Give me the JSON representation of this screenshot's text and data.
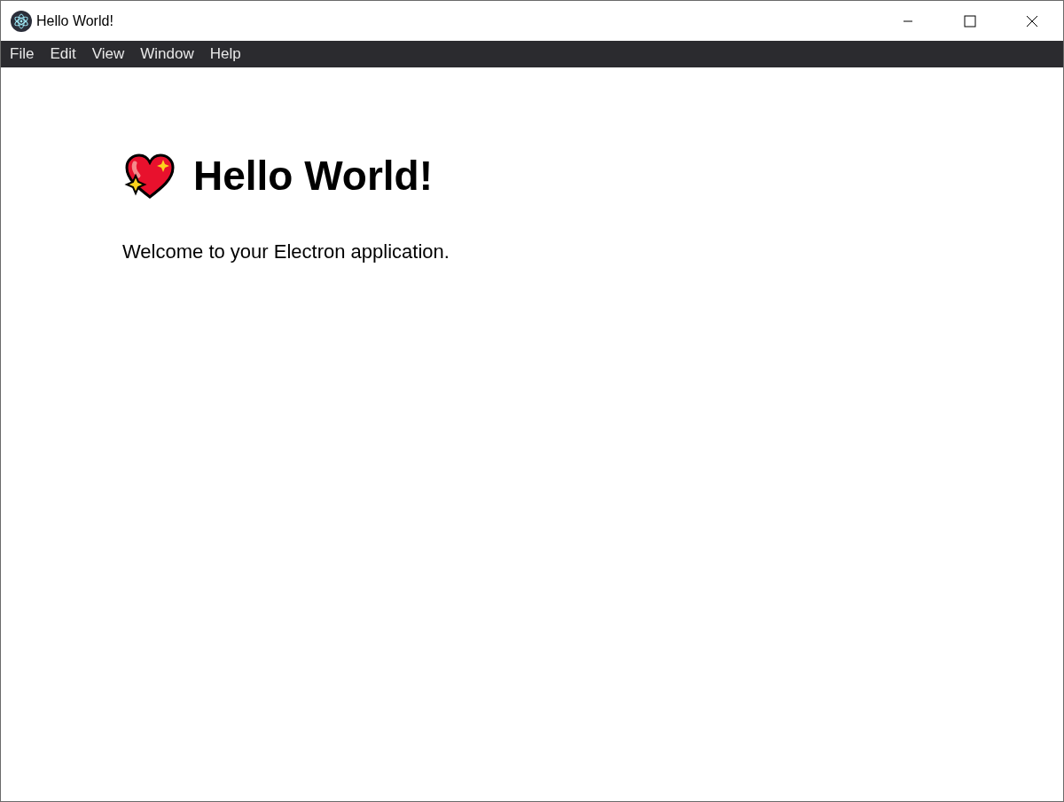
{
  "window": {
    "title": "Hello World!"
  },
  "menu_bar": [
    "File",
    "Edit",
    "View",
    "Window",
    "Help"
  ],
  "content": {
    "heading": "Hello World!",
    "text": "Welcome to your Electron application."
  }
}
